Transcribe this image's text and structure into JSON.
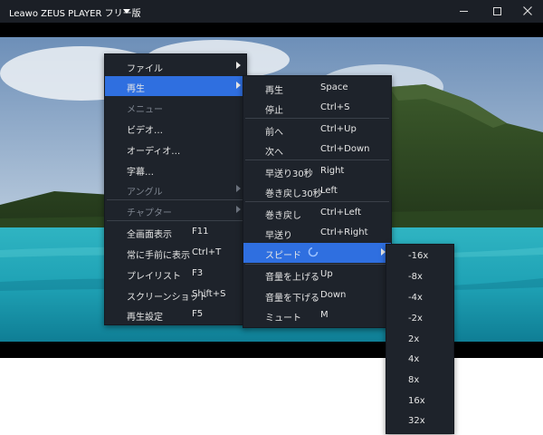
{
  "window": {
    "title": "Leawo ZEUS PLAYER フリー版"
  },
  "main_menu": {
    "items": [
      {
        "label": "ファイル",
        "shortcut": ""
      },
      {
        "label": "再生",
        "shortcut": ""
      },
      {
        "label": "メニュー",
        "shortcut": ""
      },
      {
        "label": "ビデオ…",
        "shortcut": ""
      },
      {
        "label": "オーディオ…",
        "shortcut": ""
      },
      {
        "label": "字幕…",
        "shortcut": ""
      },
      {
        "label": "アングル",
        "shortcut": ""
      },
      {
        "label": "チャプター",
        "shortcut": ""
      },
      {
        "label": "全画面表示",
        "shortcut": "F11"
      },
      {
        "label": "常に手前に表示",
        "shortcut": "Ctrl+T"
      },
      {
        "label": "プレイリスト",
        "shortcut": "F3"
      },
      {
        "label": "スクリーンショット",
        "shortcut": "Shift+S"
      },
      {
        "label": "再生設定",
        "shortcut": "F5"
      }
    ]
  },
  "play_menu": {
    "items": [
      {
        "label": "再生",
        "shortcut": "Space"
      },
      {
        "label": "停止",
        "shortcut": "Ctrl+S"
      },
      {
        "label": "前へ",
        "shortcut": "Ctrl+Up"
      },
      {
        "label": "次へ",
        "shortcut": "Ctrl+Down"
      },
      {
        "label": "早送り30秒",
        "shortcut": "Right"
      },
      {
        "label": "巻き戻し30秒",
        "shortcut": "Left"
      },
      {
        "label": "巻き戻し",
        "shortcut": "Ctrl+Left"
      },
      {
        "label": "早送り",
        "shortcut": "Ctrl+Right"
      },
      {
        "label": "スピード",
        "shortcut": ""
      },
      {
        "label": "音量を上げる",
        "shortcut": "Up"
      },
      {
        "label": "音量を下げる",
        "shortcut": "Down"
      },
      {
        "label": "ミュート",
        "shortcut": "M"
      }
    ]
  },
  "speed_menu": {
    "items": [
      {
        "label": "-16x"
      },
      {
        "label": "-8x"
      },
      {
        "label": "-4x"
      },
      {
        "label": "-2x"
      },
      {
        "label": "2x"
      },
      {
        "label": "4x"
      },
      {
        "label": "8x"
      },
      {
        "label": "16x"
      },
      {
        "label": "32x"
      }
    ]
  },
  "colors": {
    "titlebar": "#1b1f26",
    "menu_bg": "#1e232b",
    "highlight": "#2f6fe0",
    "disabled_text": "#7f8691"
  }
}
